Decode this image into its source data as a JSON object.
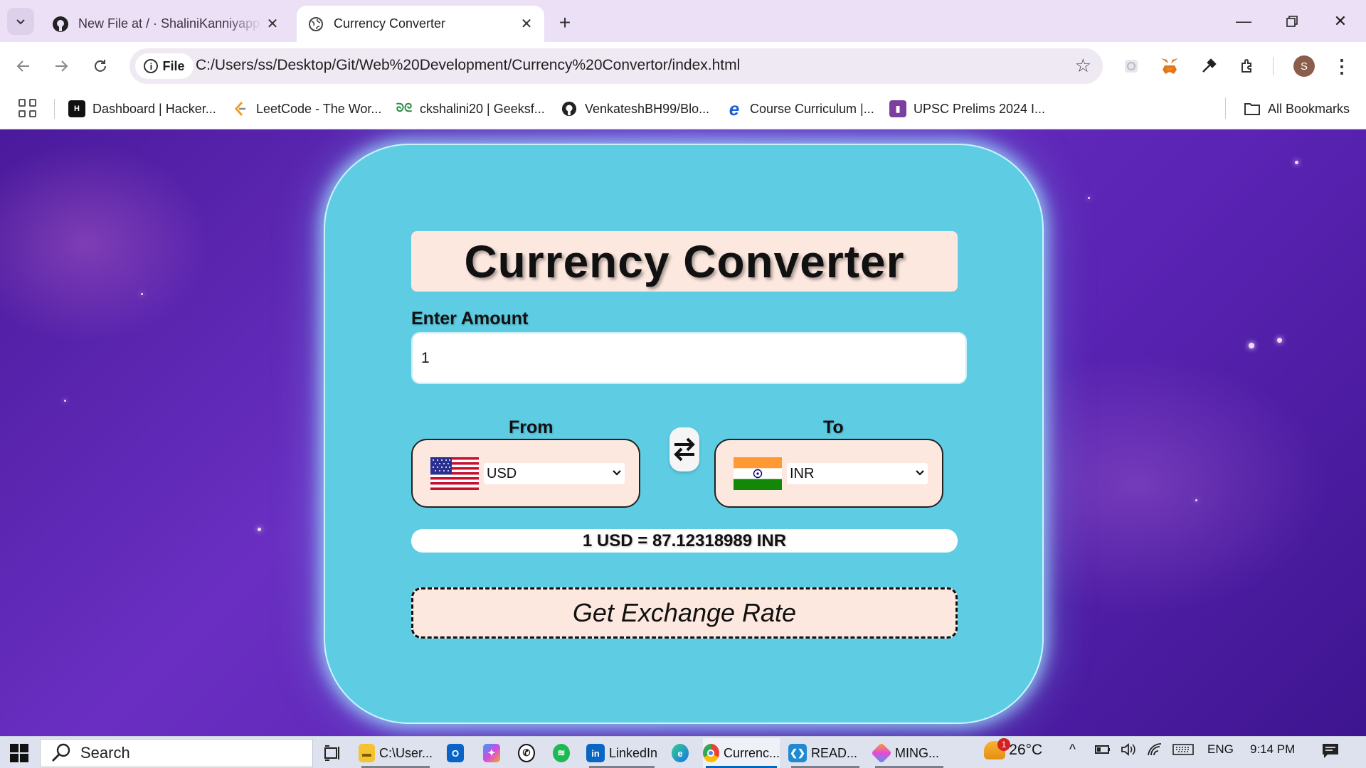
{
  "browser": {
    "tabs": [
      {
        "title": "New File at / · ShaliniKanniyappan",
        "icon": "github-icon"
      },
      {
        "title": "Currency Converter",
        "icon": "globe-icon"
      }
    ],
    "address": {
      "chip": "File",
      "url": "C:/Users/ss/Desktop/Git/Web%20Development/Currency%20Convertor/index.html"
    },
    "bookmarks": [
      {
        "label": "Dashboard | Hacker...",
        "icon": "hackerrank-icon"
      },
      {
        "label": "LeetCode - The Wor...",
        "icon": "leetcode-icon"
      },
      {
        "label": "ckshalini20 | Geeksf...",
        "icon": "geeksforgeeks-icon"
      },
      {
        "label": "VenkateshBH99/Blo...",
        "icon": "github-icon"
      },
      {
        "label": "Course Curriculum |...",
        "icon": "edureka-icon"
      },
      {
        "label": "UPSC Prelims 2024 I...",
        "icon": "book-icon"
      }
    ],
    "all_bookmarks": "All Bookmarks",
    "profile_initial": "S"
  },
  "app": {
    "title": "Currency Converter",
    "amount_label": "Enter Amount",
    "amount_value": "1",
    "from_label": "From",
    "to_label": "To",
    "from_currency": "USD",
    "to_currency": "INR",
    "result": "1 USD = 87.12318989 INR",
    "button": "Get Exchange Rate",
    "colors": {
      "card": "#5ecde4",
      "panel": "#fde8df",
      "background": "#5a23b3"
    }
  },
  "taskbar": {
    "search": "Search",
    "items": [
      {
        "label": "C:\\User...",
        "icon": "folder-icon"
      },
      {
        "label": "",
        "icon": "outlook-icon"
      },
      {
        "label": "",
        "icon": "copilot-icon"
      },
      {
        "label": "",
        "icon": "whatsapp-icon"
      },
      {
        "label": "",
        "icon": "spotify-icon"
      },
      {
        "label": "LinkedIn",
        "icon": "linkedin-icon"
      },
      {
        "label": "",
        "icon": "edge-icon"
      },
      {
        "label": "Currenc...",
        "icon": "chrome-icon"
      },
      {
        "label": "READ...",
        "icon": "vscode-icon"
      },
      {
        "label": "MING...",
        "icon": "git-icon"
      }
    ],
    "weather": "26°C",
    "weather_badge": "1",
    "language": "ENG",
    "time": "9:14 PM"
  }
}
